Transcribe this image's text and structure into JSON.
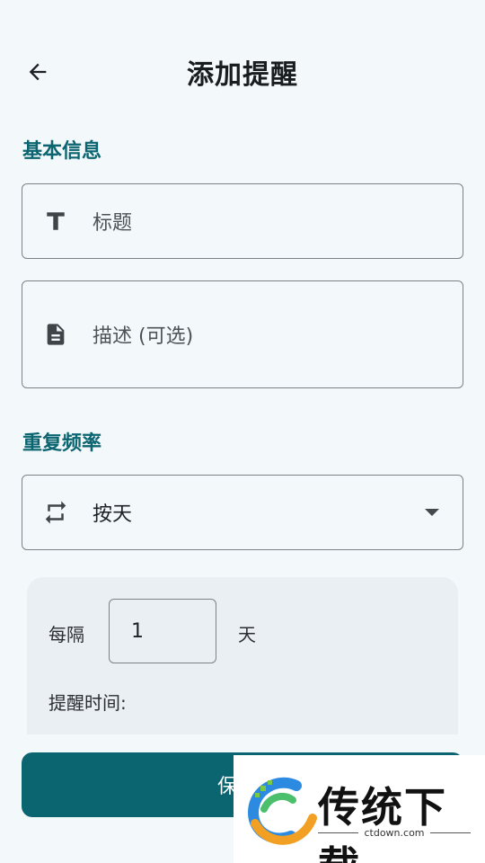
{
  "header": {
    "title": "添加提醒"
  },
  "basic_section": {
    "label": "基本信息",
    "title_placeholder": "标题",
    "description_placeholder": "描述 (可选)"
  },
  "repeat_section": {
    "label": "重复频率",
    "frequency_value": "按天",
    "interval_prefix": "每隔",
    "interval_value": "1",
    "interval_unit": "天",
    "reminder_time_label": "提醒时间:"
  },
  "save_button": {
    "label": "保"
  },
  "watermark": {
    "brand": "传统下载",
    "domain": "ctdown.com"
  },
  "icons": {
    "back": "arrow-left-icon",
    "title_field": "text-format-icon",
    "description_field": "document-icon",
    "frequency": "repeat-icon",
    "dropdown": "chevron-down-icon"
  },
  "colors": {
    "accent": "#0b6570",
    "background": "#f3f8fb",
    "card": "#e9eff3"
  }
}
